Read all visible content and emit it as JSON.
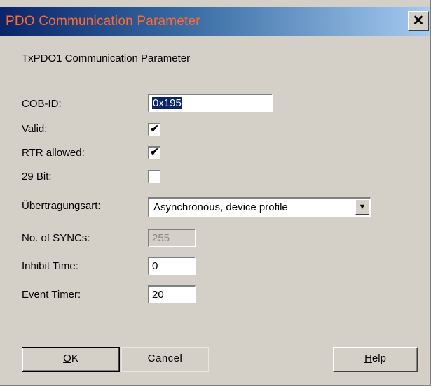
{
  "window": {
    "title": "PDO Communication Parameter",
    "close_glyph": "✕"
  },
  "section_title": "TxPDO1 Communication Parameter",
  "fields": {
    "cob_id": {
      "label": "COB-ID:",
      "value": "0x195"
    },
    "valid": {
      "label": "Valid:",
      "checked": true,
      "glyph": "✔"
    },
    "rtr_allowed": {
      "label": "RTR allowed:",
      "checked": true,
      "glyph": "✔"
    },
    "bit29": {
      "label": "29 Bit:",
      "checked": false,
      "glyph": ""
    },
    "uebertragungsart": {
      "label": "Übertragungsart:",
      "value": "Asynchronous, device profile",
      "arrow_glyph": "▼"
    },
    "no_of_syncs": {
      "label": "No. of SYNCs:",
      "value": "255",
      "disabled": true
    },
    "inhibit_time": {
      "label": "Inhibit Time:",
      "value": "0"
    },
    "event_timer": {
      "label": "Event Timer:",
      "value": "20"
    }
  },
  "buttons": {
    "ok": {
      "accel": "O",
      "rest": "K"
    },
    "cancel": {
      "label": "Cancel"
    },
    "help": {
      "accel": "H",
      "rest": "elp"
    }
  },
  "colors": {
    "title_text": "#ff6a30",
    "title_gradient_start": "#0a246a",
    "title_gradient_end": "#a6caf0",
    "dialog_bg": "#d4d0c8",
    "selection": "#0a246a"
  }
}
